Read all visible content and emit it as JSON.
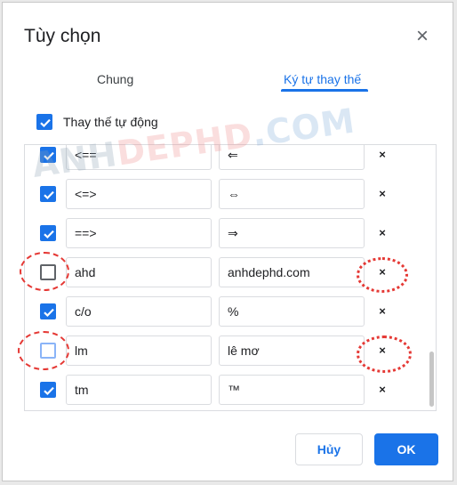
{
  "dialog": {
    "title": "Tùy chọn",
    "close_icon": "×"
  },
  "tabs": [
    {
      "label": "Chung",
      "active": false
    },
    {
      "label": "Ký tự thay thế",
      "active": true
    }
  ],
  "auto_replace": {
    "label": "Thay thế tự động",
    "checked": true
  },
  "rows": [
    {
      "from": "<==",
      "to": "⇐",
      "checked": true
    },
    {
      "from": "<=>",
      "to": "⇔",
      "checked": true
    },
    {
      "from": "==>",
      "to": "⇒",
      "checked": true
    },
    {
      "from": "ahd",
      "to": "anhdephd.com",
      "checked": false
    },
    {
      "from": "c/o",
      "to": "%",
      "checked": true
    },
    {
      "from": "lm",
      "to": "lê mơ",
      "checked": false
    },
    {
      "from": "tm",
      "to": "™",
      "checked": true
    }
  ],
  "delete_icon": "×",
  "watermark": {
    "part1": "ANH",
    "part2": "DEP",
    "part3": "HD",
    "part4": ".COM"
  },
  "buttons": {
    "cancel": "Hủy",
    "ok": "OK"
  },
  "colors": {
    "accent": "#1a73e8",
    "annotation": "#e53935"
  }
}
